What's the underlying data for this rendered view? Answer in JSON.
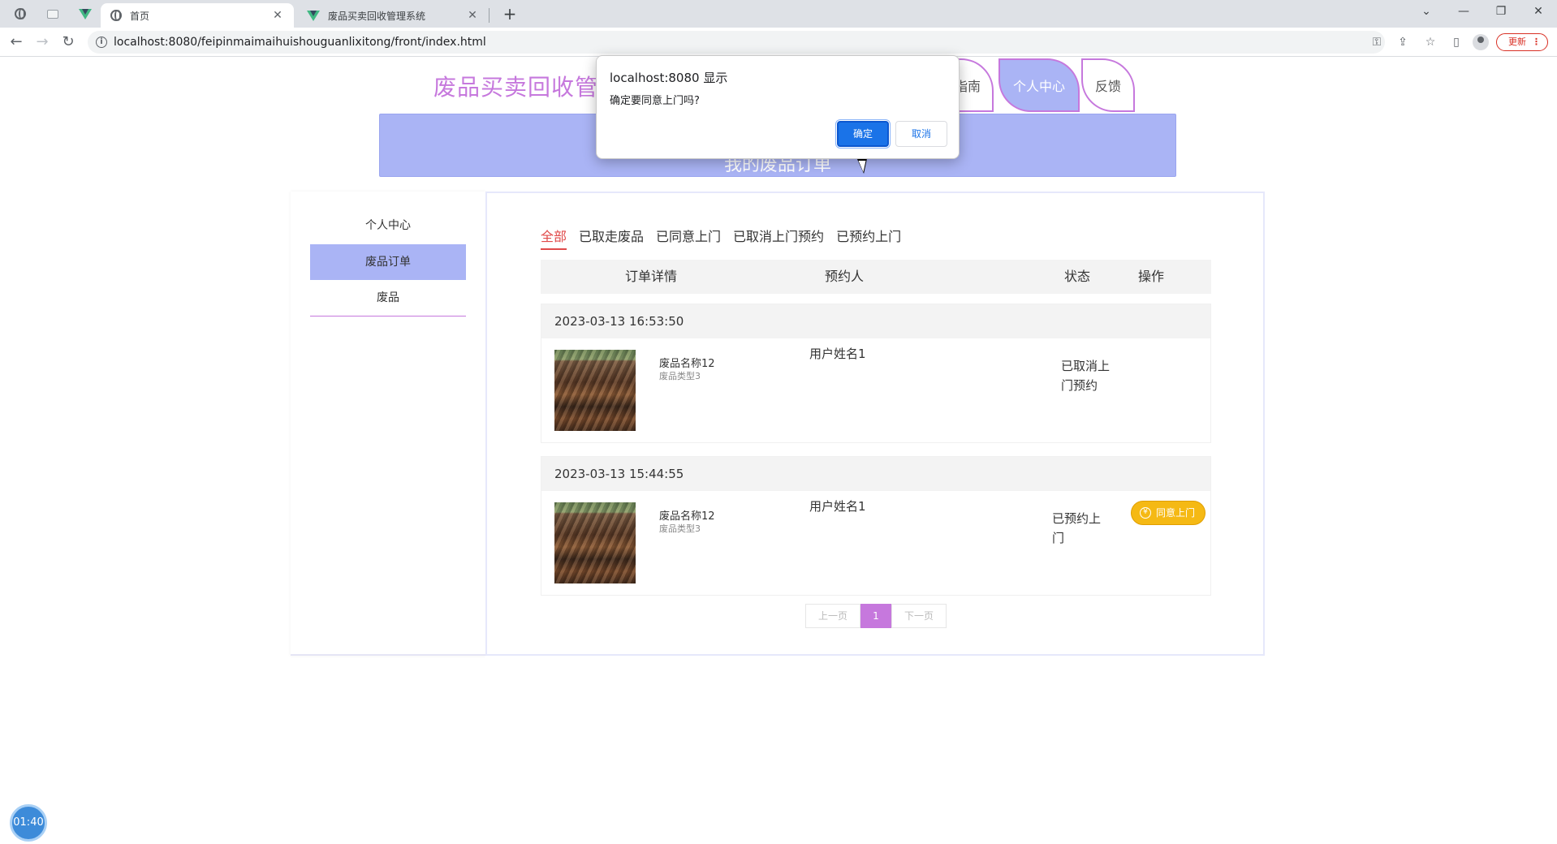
{
  "browser": {
    "tabs": [
      {
        "title": "首页",
        "active": true
      },
      {
        "title": "废品买卖回收管理系统",
        "active": false
      }
    ],
    "url": "localhost:8080/feipinmaimaihuishouguanlixitong/front/index.html",
    "update_label": "更新"
  },
  "site": {
    "title": "废品买卖回收管理",
    "nav": [
      {
        "label": "指南"
      },
      {
        "label": "个人中心",
        "active": true
      },
      {
        "label": "反馈"
      }
    ],
    "banner_title": "我的废品订单"
  },
  "sidebar": {
    "items": [
      {
        "label": "个人中心"
      },
      {
        "label": "废品订单",
        "active": true
      },
      {
        "label": "废品"
      }
    ]
  },
  "filters": [
    "全部",
    "已取走废品",
    "已同意上门",
    "已取消上门预约",
    "已预约上门"
  ],
  "table": {
    "headers": {
      "detail": "订单详情",
      "reserver": "预约人",
      "status": "状态",
      "action": "操作"
    }
  },
  "orders": [
    {
      "time": "2023-03-13 16:53:50",
      "item_name": "废品名称12",
      "item_type": "废品类型3",
      "reserver": "用户姓名1",
      "status_line1": "已取消上",
      "status_line2": "门预约",
      "action": ""
    },
    {
      "time": "2023-03-13 15:44:55",
      "item_name": "废品名称12",
      "item_type": "废品类型3",
      "reserver": "用户姓名1",
      "status_line1": "已预约上",
      "status_line2": "门",
      "action": "同意上门"
    }
  ],
  "pager": {
    "prev": "上一页",
    "current": "1",
    "next": "下一页"
  },
  "dialog": {
    "title": "localhost:8080 显示",
    "message": "确定要同意上门吗?",
    "ok": "确定",
    "cancel": "取消"
  },
  "timer": "01:40",
  "colors": {
    "accent": "#c678dd",
    "banner": "#aab4f5",
    "action": "#f5b914",
    "active_filter": "#e04a4a"
  }
}
